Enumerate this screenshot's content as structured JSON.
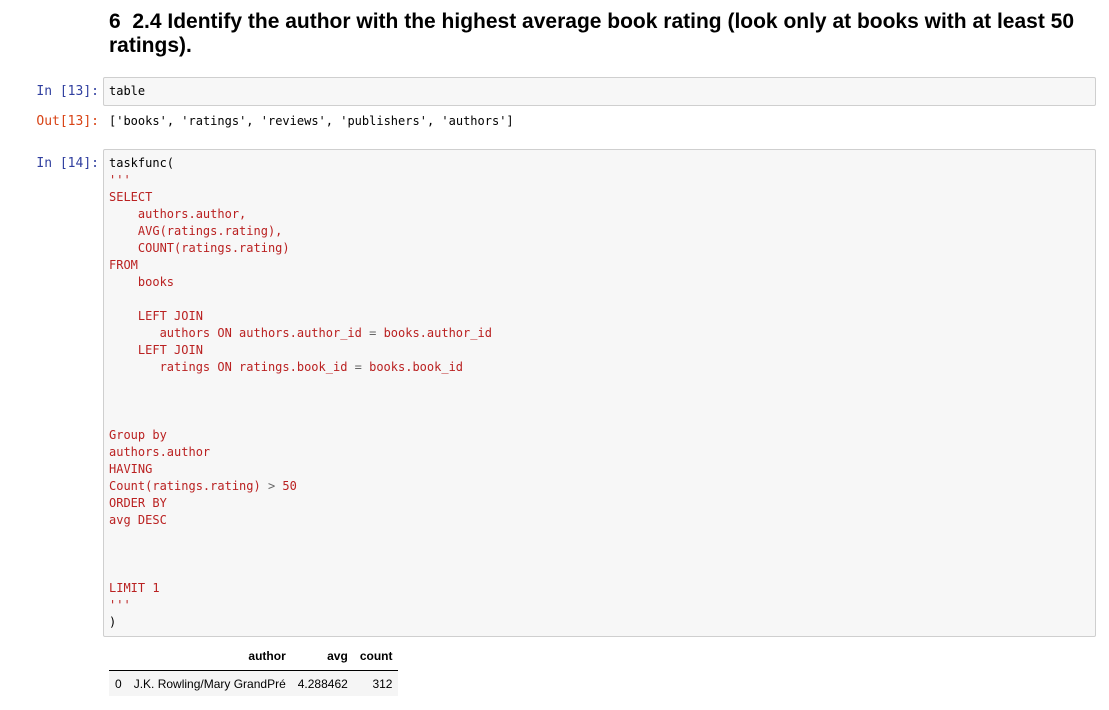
{
  "heading": {
    "number": "6",
    "title": "2.4 Identify the author with the highest average book rating (look only at books with at least 50 ratings)."
  },
  "cells": [
    {
      "in_prompt": "In [13]:",
      "code": "table",
      "out_prompt": "Out[13]:",
      "output": {
        "open": "[",
        "items": [
          "'books'",
          "'ratings'",
          "'reviews'",
          "'publishers'",
          "'authors'"
        ],
        "sep": ", ",
        "close": "]"
      }
    },
    {
      "in_prompt": "In [14]:",
      "call_open": "taskfunc(",
      "sql_lines": [
        "'''",
        "SELECT",
        "    authors.author,",
        "    AVG(ratings.rating),",
        "    COUNT(ratings.rating)",
        "FROM",
        "    books",
        "",
        "    LEFT JOIN",
        "       authors ON authors.author_id = books.author_id",
        "    LEFT JOIN",
        "       ratings ON ratings.book_id = books.book_id",
        "",
        "",
        "",
        "Group by",
        "authors.author",
        "HAVING",
        "Count(ratings.rating) > 50",
        "ORDER BY",
        "avg DESC",
        "",
        "",
        "",
        "LIMIT 1",
        "'''"
      ],
      "call_close": ")",
      "result_table": {
        "columns": [
          "",
          "author",
          "avg",
          "count"
        ],
        "rows": [
          [
            "0",
            "J.K. Rowling/Mary GrandPré",
            "4.288462",
            "312"
          ]
        ]
      }
    }
  ]
}
